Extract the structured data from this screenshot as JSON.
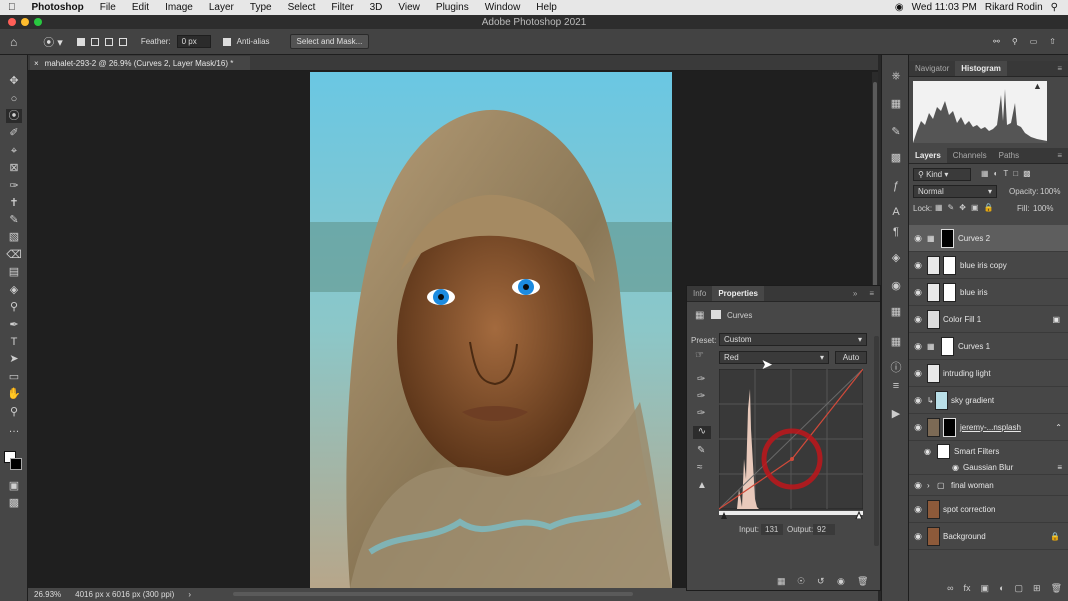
{
  "menubar": {
    "app": "Photoshop",
    "items": [
      "File",
      "Edit",
      "Image",
      "Layer",
      "Type",
      "Select",
      "Filter",
      "3D",
      "View",
      "Plugins",
      "Window",
      "Help"
    ],
    "clock": "Wed 11:03 PM",
    "user": "Rikard Rodin"
  },
  "window": {
    "title": "Adobe Photoshop 2021"
  },
  "options": {
    "feather_label": "Feather:",
    "feather_value": "0 px",
    "antialias_label": "Anti-alias",
    "select_mask_label": "Select and Mask..."
  },
  "document": {
    "tab_title": "mahalet-293-2 @ 26.9% (Curves 2, Layer Mask/16) *"
  },
  "status": {
    "zoom": "26.93%",
    "size": "4016 px x 6016 px (300 ppi)"
  },
  "histogram_panel": {
    "tabs": [
      "Navigator",
      "Histogram"
    ],
    "active": "Histogram"
  },
  "layers_panel": {
    "tabs": [
      "Layers",
      "Channels",
      "Paths"
    ],
    "kind_label": "Kind",
    "blend_mode": "Normal",
    "opacity_label": "Opacity:",
    "opacity_value": "100%",
    "lock_label": "Lock:",
    "fill_label": "Fill:",
    "fill_value": "100%",
    "layers": [
      {
        "name": "Curves 2"
      },
      {
        "name": "blue iris copy"
      },
      {
        "name": "blue iris"
      },
      {
        "name": "Color Fill 1"
      },
      {
        "name": "Curves 1"
      },
      {
        "name": "intruding light"
      },
      {
        "name": "sky gradient"
      },
      {
        "name": "jeremy-...nsplash"
      },
      {
        "name": "Smart Filters"
      },
      {
        "name": "Gaussian Blur"
      },
      {
        "name": "final woman"
      },
      {
        "name": "spot correction"
      },
      {
        "name": "Background"
      }
    ]
  },
  "properties_panel": {
    "tabs": [
      "Info",
      "Properties"
    ],
    "active": "Properties",
    "type_label": "Curves",
    "preset_label": "Preset:",
    "preset_value": "Custom",
    "channel_value": "Red",
    "auto_label": "Auto",
    "input_label": "Input:",
    "input_value": "131",
    "output_label": "Output:",
    "output_value": "92"
  },
  "colors": {
    "accent_red": "#c0161b",
    "curve_line": "#d04a3a",
    "ui_bg": "#474747"
  }
}
